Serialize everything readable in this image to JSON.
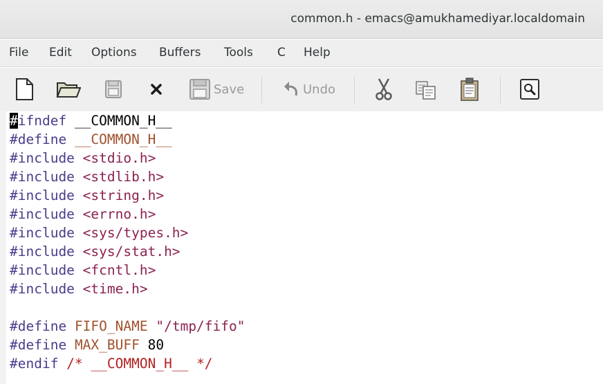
{
  "window": {
    "title": "common.h - emacs@amukhamediyar.localdomain"
  },
  "menubar": {
    "items": [
      "File",
      "Edit",
      "Options",
      "Buffers",
      "Tools",
      "C",
      "Help"
    ]
  },
  "toolbar": {
    "new_icon": "new-file-icon",
    "open_icon": "open-folder-icon",
    "save_buffer_icon": "floppy-disk-icon",
    "close_icon": "close-x-icon",
    "save_label": "Save",
    "undo_label": "Undo",
    "cut_icon": "scissors-icon",
    "copy_icon": "copy-icon",
    "paste_icon": "clipboard-icon",
    "search_icon": "magnifier-icon"
  },
  "editor": {
    "lines": [
      [
        {
          "t": "#",
          "c": "cursor"
        },
        {
          "t": "ifndef",
          "c": "pp"
        },
        {
          "t": " __COMMON_H__",
          "c": ""
        }
      ],
      [
        {
          "t": "#define",
          "c": "pp"
        },
        {
          "t": " ",
          "c": ""
        },
        {
          "t": "__COMMON_H__",
          "c": "var"
        }
      ],
      [
        {
          "t": "#include",
          "c": "pp"
        },
        {
          "t": " ",
          "c": ""
        },
        {
          "t": "<stdio.h>",
          "c": "str"
        }
      ],
      [
        {
          "t": "#include",
          "c": "pp"
        },
        {
          "t": " ",
          "c": ""
        },
        {
          "t": "<stdlib.h>",
          "c": "str"
        }
      ],
      [
        {
          "t": "#include",
          "c": "pp"
        },
        {
          "t": " ",
          "c": ""
        },
        {
          "t": "<string.h>",
          "c": "str"
        }
      ],
      [
        {
          "t": "#include",
          "c": "pp"
        },
        {
          "t": " ",
          "c": ""
        },
        {
          "t": "<errno.h>",
          "c": "str"
        }
      ],
      [
        {
          "t": "#include",
          "c": "pp"
        },
        {
          "t": " ",
          "c": ""
        },
        {
          "t": "<sys/types.h>",
          "c": "str"
        }
      ],
      [
        {
          "t": "#include",
          "c": "pp"
        },
        {
          "t": " ",
          "c": ""
        },
        {
          "t": "<sys/stat.h>",
          "c": "str"
        }
      ],
      [
        {
          "t": "#include",
          "c": "pp"
        },
        {
          "t": " ",
          "c": ""
        },
        {
          "t": "<fcntl.h>",
          "c": "str"
        }
      ],
      [
        {
          "t": "#include",
          "c": "pp"
        },
        {
          "t": " ",
          "c": ""
        },
        {
          "t": "<time.h>",
          "c": "str"
        }
      ],
      [],
      [
        {
          "t": "#define",
          "c": "pp"
        },
        {
          "t": " ",
          "c": ""
        },
        {
          "t": "FIFO_NAME",
          "c": "var"
        },
        {
          "t": " ",
          "c": ""
        },
        {
          "t": "\"/tmp/fifo\"",
          "c": "str"
        }
      ],
      [
        {
          "t": "#define",
          "c": "pp"
        },
        {
          "t": " ",
          "c": ""
        },
        {
          "t": "MAX_BUFF",
          "c": "var"
        },
        {
          "t": " 80",
          "c": ""
        }
      ],
      [
        {
          "t": "#endif",
          "c": "pp"
        },
        {
          "t": " ",
          "c": ""
        },
        {
          "t": "/* ",
          "c": "cmt"
        },
        {
          "t": "__COMMON_H__",
          "c": "cmt"
        },
        {
          "t": " */",
          "c": "cmt"
        }
      ]
    ]
  },
  "colors": {
    "preprocessor": "#483d8b",
    "string": "#8b2252",
    "variable": "#a0522d",
    "comment": "#b22222"
  }
}
